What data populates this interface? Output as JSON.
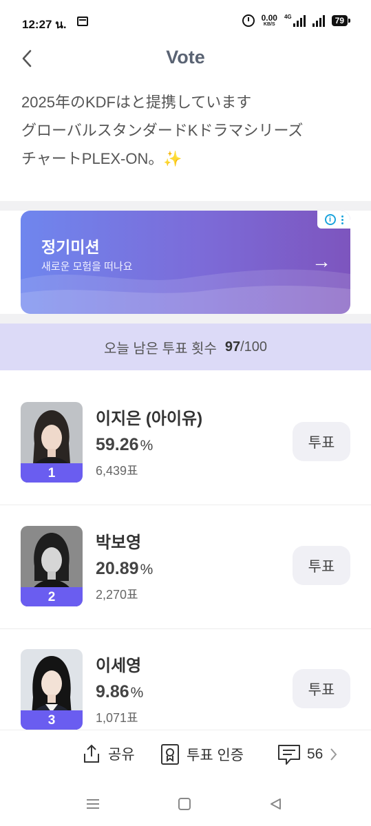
{
  "status_bar": {
    "time": "12:27 น.",
    "speed_value": "0.00",
    "speed_unit": "KB/S",
    "network": "4G",
    "battery": "79"
  },
  "header": {
    "title": "Vote"
  },
  "description": {
    "lines": [
      "2025年のKDFはと提携しています",
      "グローバルスタンダードKドラマシリーズ",
      "チャートPLEX-ON。✨"
    ]
  },
  "banner": {
    "title": "정기미션",
    "subtitle": "새로운 모험을 떠나요",
    "arrow": "→",
    "ad_info": "i"
  },
  "remaining": {
    "label": "오늘 남은 투표 횟수",
    "count": "97",
    "total": "/100"
  },
  "candidates": [
    {
      "rank": "1",
      "name": "이지은 (아이유)",
      "percent": "59.26",
      "percent_symbol": "%",
      "votes": "6,439표",
      "vote_button": "투표"
    },
    {
      "rank": "2",
      "name": "박보영",
      "percent": "20.89",
      "percent_symbol": "%",
      "votes": "2,270표",
      "vote_button": "투표"
    },
    {
      "rank": "3",
      "name": "이세영",
      "percent": "9.86",
      "percent_symbol": "%",
      "votes": "1,071표",
      "vote_button": "투표"
    }
  ],
  "actions": {
    "share_label": "공유",
    "certify_label": "투표 인증",
    "comments_count": "56"
  },
  "icons": {
    "back": "chevron-left-icon",
    "share": "share-icon",
    "certify": "certificate-icon",
    "comment": "comment-icon",
    "more": "chevron-right-icon"
  },
  "colors": {
    "accent": "#6a5df0",
    "remaining_bg": "#dcdaf7",
    "title": "#5a6373"
  }
}
